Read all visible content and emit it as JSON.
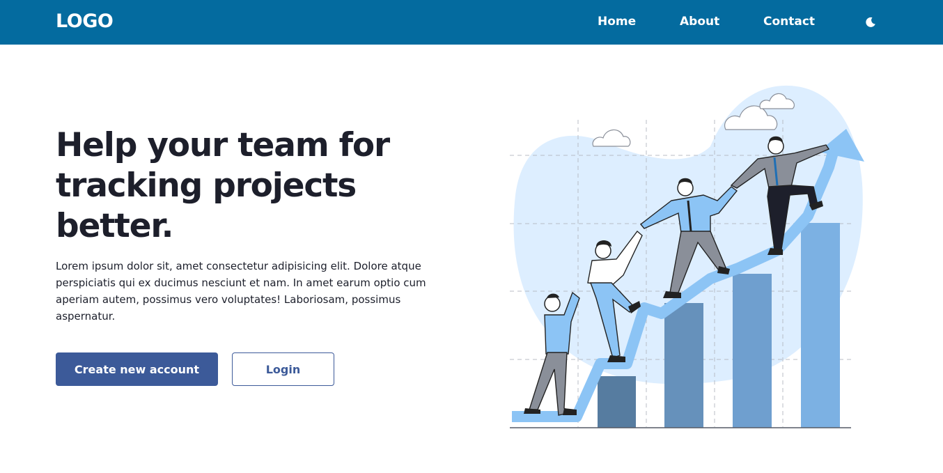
{
  "navbar": {
    "logo": "LOGO",
    "links": [
      {
        "label": "Home"
      },
      {
        "label": "About"
      },
      {
        "label": "Contact"
      }
    ],
    "theme_icon": "moon-icon"
  },
  "hero": {
    "title": "Help your team for tracking projects better.",
    "description": "Lorem ipsum dolor sit, amet consectetur adipisicing elit. Dolore atque perspiciatis qui ex ducimus nesciunt et nam. In amet earum optio cum aperiam autem, possimus vero voluptates! Laboriosam, possimus aspernatur.",
    "primary_button": "Create new account",
    "secondary_button": "Login"
  },
  "colors": {
    "navbar": "#046b9f",
    "primary": "#3c5a99",
    "text": "#1c1f2b",
    "illustration_blob": "#ddeeff",
    "illustration_arrow": "#8cc4f5"
  },
  "illustration": {
    "subject": "people-climbing-growth-chart"
  }
}
